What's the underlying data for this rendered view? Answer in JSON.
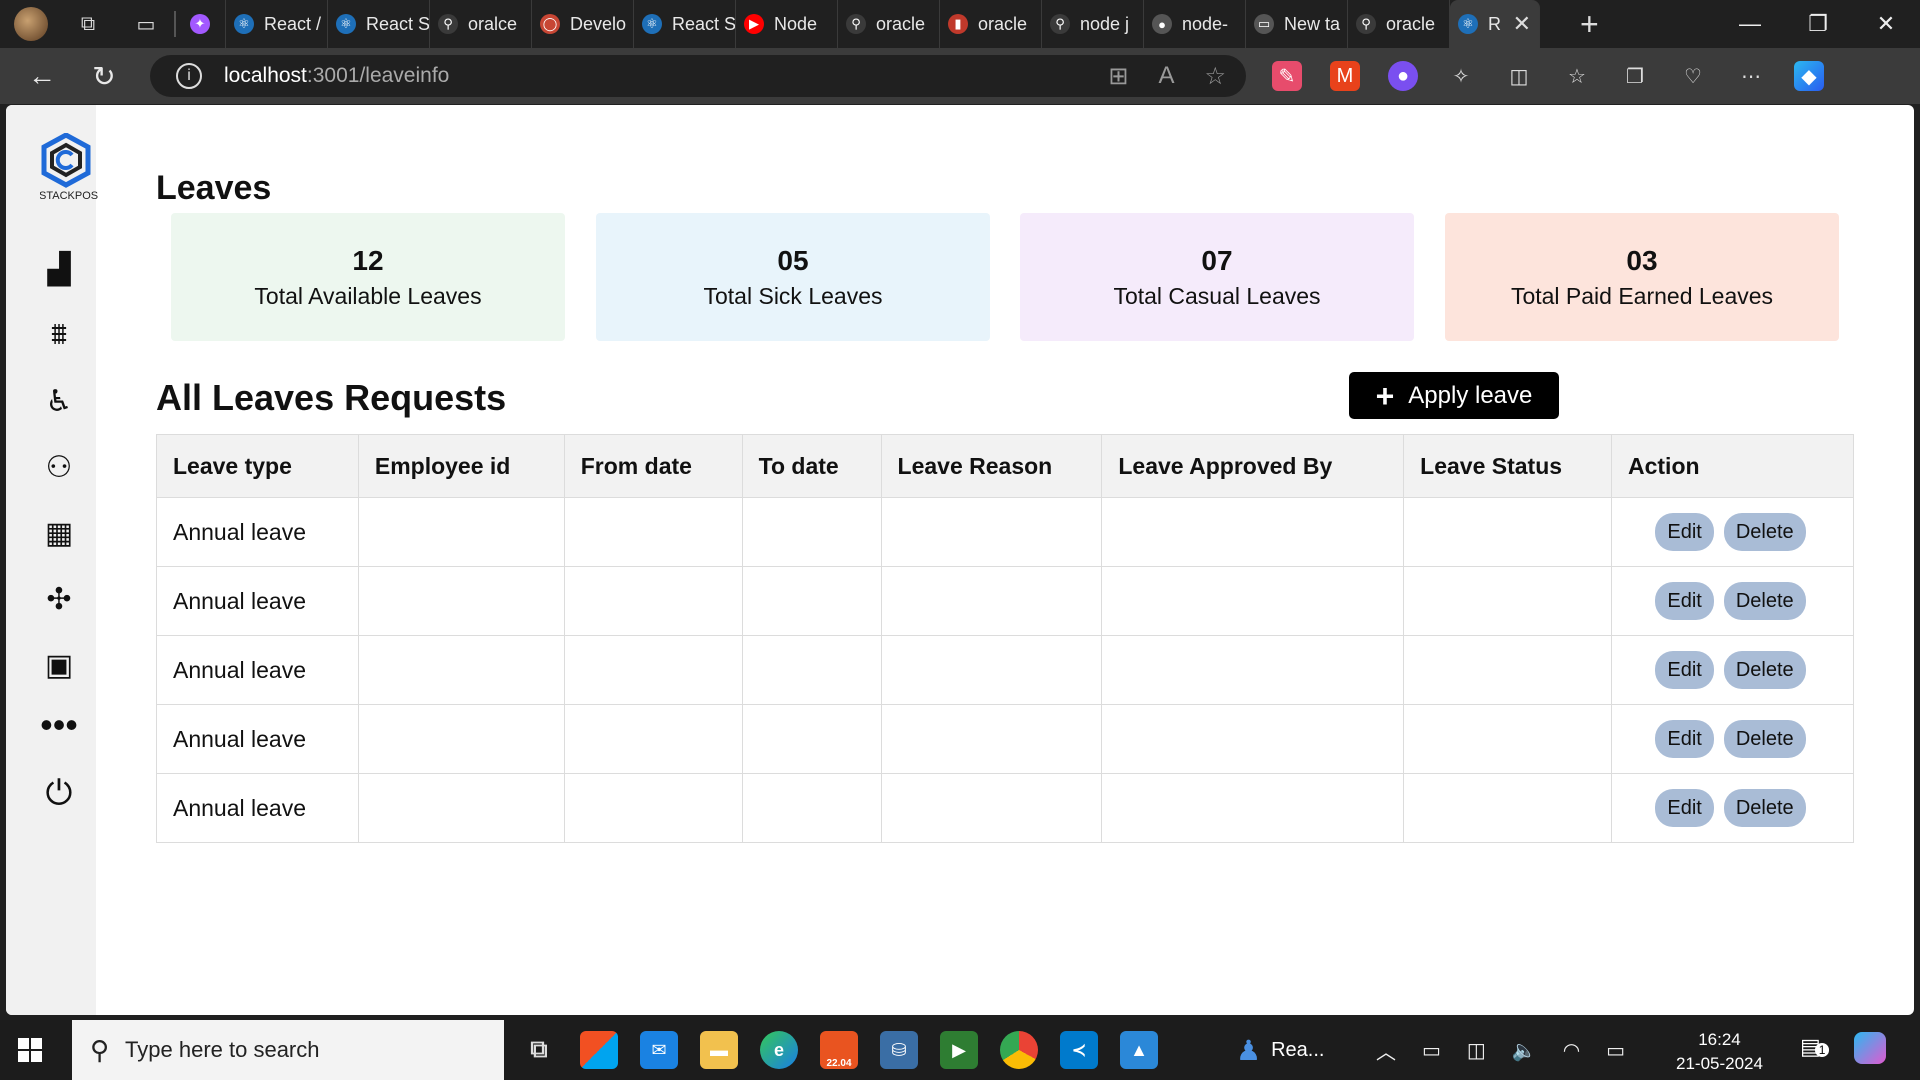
{
  "browser": {
    "tabs": [
      {
        "label": "",
        "color": "#a259ff",
        "icon": "figma-icon"
      },
      {
        "label": "React /",
        "color": "#1e6fb8",
        "icon": "react-icon"
      },
      {
        "label": "React S",
        "color": "#1e6fb8",
        "icon": "react-icon"
      },
      {
        "label": "oralce",
        "color": "#3a3a3a",
        "icon": "search-icon"
      },
      {
        "label": "Develo",
        "color": "#c74634",
        "icon": "oracle-icon"
      },
      {
        "label": "React S",
        "color": "#1e6fb8",
        "icon": "react-icon"
      },
      {
        "label": "Node",
        "color": "#ff0000",
        "icon": "youtube-icon"
      },
      {
        "label": "oracle",
        "color": "#3a3a3a",
        "icon": "search-icon"
      },
      {
        "label": "oracle",
        "color": "#c0392b",
        "icon": "bookmark-icon"
      },
      {
        "label": "node j",
        "color": "#3a3a3a",
        "icon": "search-icon"
      },
      {
        "label": "node-",
        "color": "#555",
        "icon": "github-icon"
      },
      {
        "label": "New ta",
        "color": "#555",
        "icon": "newtab-icon"
      },
      {
        "label": "oracle",
        "color": "#3a3a3a",
        "icon": "search-icon"
      }
    ],
    "active_tab": {
      "label": "R",
      "close": "✕"
    },
    "new_tab": "+",
    "url_host": "localhost",
    "url_rest": ":3001/leaveinfo",
    "window_controls": {
      "minimize": "—",
      "restore": "❐",
      "close": "✕"
    }
  },
  "page": {
    "logo_text": "STACKPOS",
    "title": "Leaves",
    "cards": [
      {
        "value": "12",
        "label": "Total Available Leaves",
        "bg": "#edf7ef"
      },
      {
        "value": "05",
        "label": "Total Sick Leaves",
        "bg": "#e8f4fb"
      },
      {
        "value": "07",
        "label": "Total Casual Leaves",
        "bg": "#f5ebfb"
      },
      {
        "value": "03",
        "label": "Total Paid Earned Leaves",
        "bg": "#fde4dc"
      }
    ],
    "requests_title": "All Leaves Requests",
    "apply_button": "Apply leave",
    "table": {
      "headers": [
        "Leave type",
        "Employee id",
        "From date",
        "To date",
        "Leave Reason",
        "Leave Approved By",
        "Leave Status",
        "Action"
      ],
      "rows": [
        {
          "leave_type": "Annual leave"
        },
        {
          "leave_type": "Annual leave"
        },
        {
          "leave_type": "Annual leave"
        },
        {
          "leave_type": "Annual leave"
        },
        {
          "leave_type": "Annual leave"
        }
      ],
      "edit_label": "Edit",
      "delete_label": "Delete"
    }
  },
  "taskbar": {
    "search_placeholder": "Type here to search",
    "running_label": "Rea...",
    "time": "16:24",
    "date": "21-05-2024",
    "notification_count": "1",
    "ubuntu_badge": "22.04"
  }
}
